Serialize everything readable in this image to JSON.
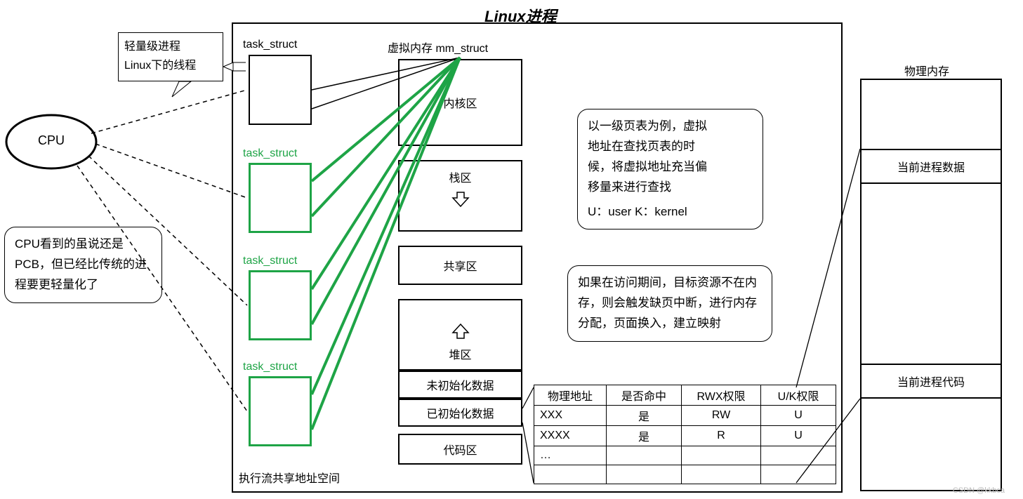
{
  "title": "Linux进程",
  "cpu": {
    "label": "CPU"
  },
  "bubble_lwp": {
    "line1": "轻量级进程",
    "line2": "Linux下的线程"
  },
  "bubble_cpu_note": "CPU看到的虽说还是PCB，但已经比传统的进程要更轻量化了",
  "task_struct_labels": {
    "black": "task_struct",
    "g1": "task_struct",
    "g2": "task_struct",
    "g3": "task_struct"
  },
  "exec_flow_label": "执行流共享地址空间",
  "mm_struct_title": "虚拟内存 mm_struct",
  "mm_segments": {
    "kernel": "内核区",
    "stack": "栈区",
    "shared": "共享区",
    "heap": "堆区",
    "bss": "未初始化数据",
    "data": "已初始化数据",
    "text": "代码区"
  },
  "note_pagetable": {
    "l1": "以一级页表为例，虚拟",
    "l2": "地址在查找页表的时",
    "l3": "候，将虚拟地址充当偏",
    "l4": "移量来进行查找",
    "l5": "U：user  K：kernel"
  },
  "note_fault": "如果在访问期间，目标资源不在内存，则会触发缺页中断，进行内存分配，页面换入，建立映射",
  "page_table": {
    "headers": [
      "物理地址",
      "是否命中",
      "RWX权限",
      "U/K权限"
    ],
    "rows": [
      [
        "XXX",
        "是",
        "RW",
        "U"
      ],
      [
        "XXXX",
        "是",
        "R",
        "U"
      ],
      [
        "…",
        "",
        "",
        ""
      ],
      [
        "",
        "",
        "",
        ""
      ]
    ]
  },
  "phys_mem": {
    "title": "物理内存",
    "proc_data": "当前进程数据",
    "proc_code": "当前进程代码"
  },
  "watermark": "CSDN @kkbca"
}
